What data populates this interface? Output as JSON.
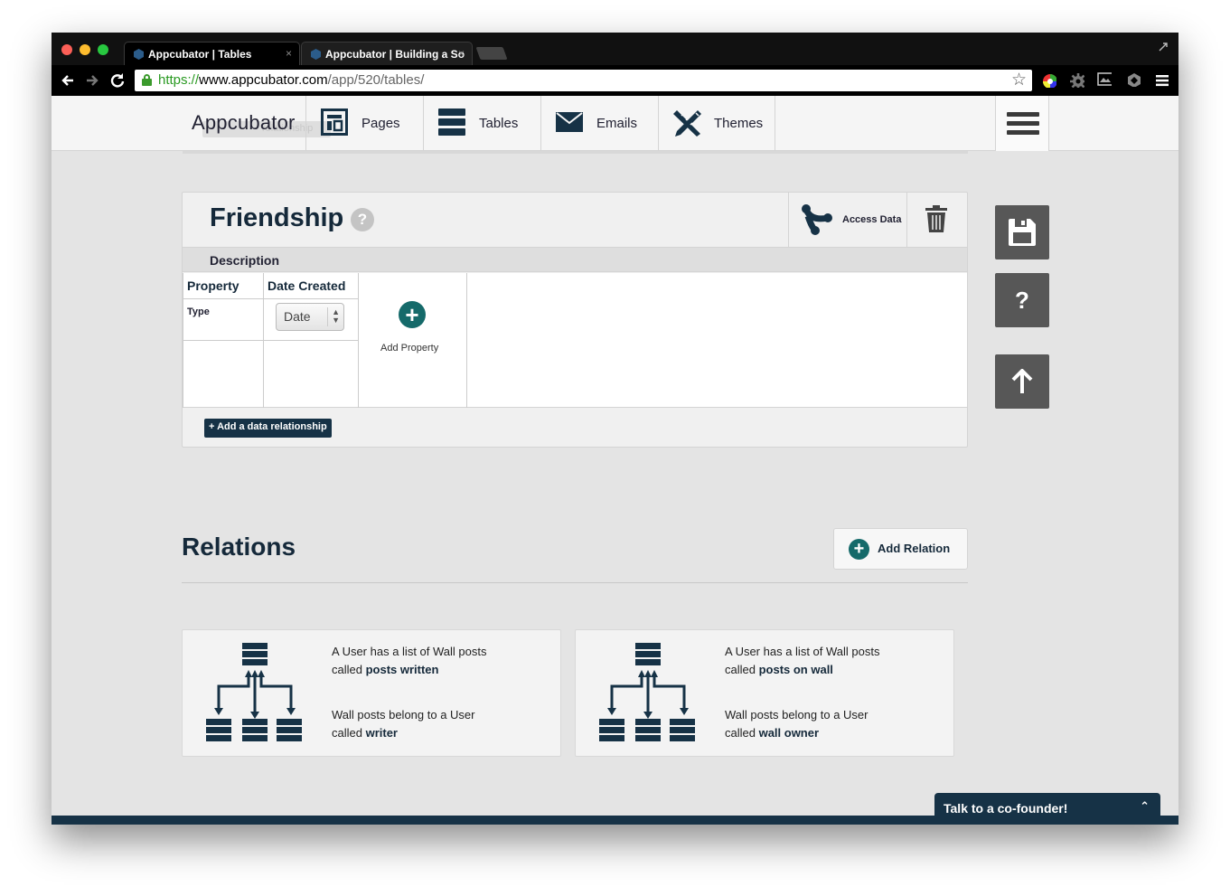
{
  "browser": {
    "tabs": [
      {
        "title": "Appcubator | Tables",
        "close": "×"
      },
      {
        "title": "Appcubator | Building a So",
        "close": "×"
      }
    ],
    "url": {
      "scheme": "https://",
      "host": "www.appcubator.com",
      "path": "/app/520/tables/"
    }
  },
  "appnav": {
    "brand": "Appcubator",
    "ghost_label": "relationship",
    "items": [
      {
        "label": "Pages",
        "icon": "pages-icon"
      },
      {
        "label": "Tables",
        "icon": "tables-icon"
      },
      {
        "label": "Emails",
        "icon": "envelope-icon"
      },
      {
        "label": "Themes",
        "icon": "pencil-ruler-icon"
      }
    ]
  },
  "table": {
    "name": "Friendship",
    "help_glyph": "?",
    "access_label": "Access Data",
    "description_label": "Description",
    "columns": [
      {
        "header": "Property",
        "type_label": "Type"
      },
      {
        "header": "Date Created",
        "type_value": "Date"
      }
    ],
    "add_property_label": "Add Property",
    "add_relationship_label": "+ Add a data relationship"
  },
  "side": {
    "help_glyph": "?"
  },
  "relations": {
    "title": "Relations",
    "add_label": "Add Relation",
    "cards": [
      {
        "line1": "A User has a list of Wall posts",
        "line2_prefix": "called ",
        "line2_name": "posts written",
        "line3": "Wall posts belong to a User",
        "line4_prefix": "called ",
        "line4_name": "writer"
      },
      {
        "line1": "A User has a list of Wall posts",
        "line2_prefix": "called ",
        "line2_name": "posts on wall",
        "line3": "Wall posts belong to a User",
        "line4_prefix": "called ",
        "line4_name": "wall owner"
      }
    ]
  },
  "chat": {
    "label": "Talk to a co-founder!",
    "chevron": "⌃"
  },
  "colors": {
    "accent": "#156a6a",
    "navy": "#163246",
    "side_button": "#575757"
  }
}
